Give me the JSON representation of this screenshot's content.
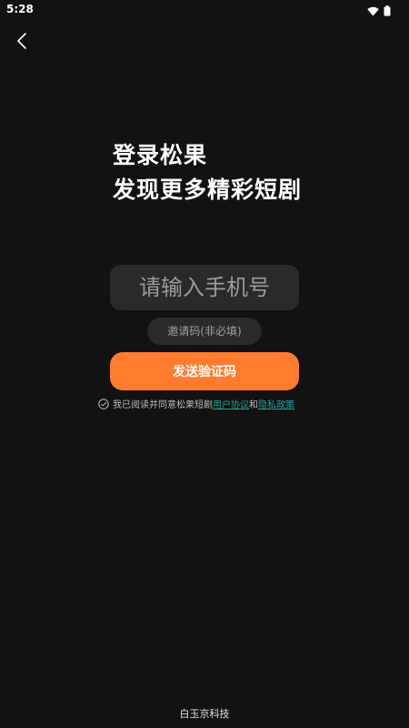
{
  "status_bar": {
    "time": "5:28"
  },
  "nav": {
    "back_icon": "chevron-left-icon"
  },
  "headline": {
    "line1": "登录松果",
    "line2": "发现更多精彩短剧"
  },
  "form": {
    "phone_placeholder": "请输入手机号",
    "phone_value": "",
    "invite_placeholder": "邀请码(非必填)",
    "invite_value": "",
    "send_button_label": "发送验证码"
  },
  "agreement": {
    "prefix": "我已阅读并同意松果短剧",
    "user_agreement": "用户协议",
    "and": "和",
    "privacy_policy": "隐私政策"
  },
  "footer": {
    "company": "白玉京科技"
  },
  "colors": {
    "background": "#121212",
    "accent": "#ff7c2e",
    "link": "#1fa39a",
    "input_bg": "#2a2a2a"
  }
}
